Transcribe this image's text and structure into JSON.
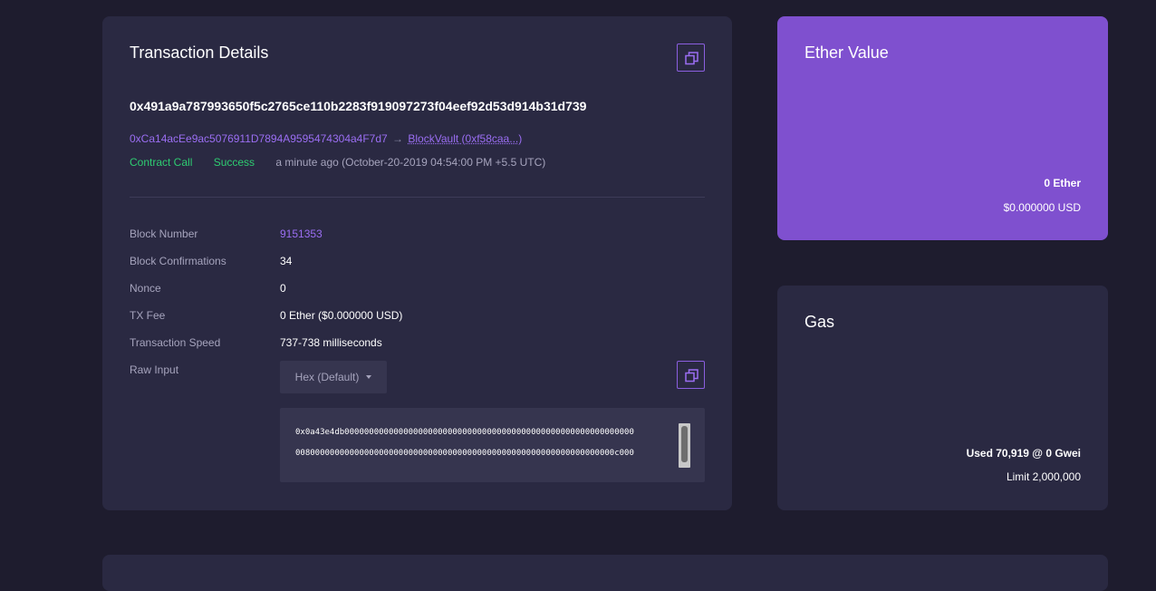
{
  "transaction": {
    "title": "Transaction Details",
    "hash": "0x491a9a787993650f5c2765ce110b2283f919097273f04eef92d53d914b31d739",
    "from": "0xCa14acEe9ac5076911D7894A9595474304a4F7d7",
    "arrow": "→",
    "to": "BlockVault (0xf58caa...)",
    "type": "Contract Call",
    "status": "Success",
    "time": "a minute ago (October-20-2019 04:54:00 PM +5.5 UTC)",
    "details": {
      "block_number_label": "Block Number",
      "block_number": "9151353",
      "confirmations_label": "Block Confirmations",
      "confirmations": "34",
      "nonce_label": "Nonce",
      "nonce": "0",
      "fee_label": "TX Fee",
      "fee": "0 Ether ($0.000000 USD)",
      "speed_label": "Transaction Speed",
      "speed": "737-738 milliseconds",
      "raw_input_label": "Raw Input",
      "raw_format": "Hex (Default)",
      "raw_line_1": "0x0a43e4db00000000000000000000000000000000000000000000000000000000000",
      "raw_line_2": "00800000000000000000000000000000000000000000000000000000000000000c000"
    }
  },
  "ether_value": {
    "title": "Ether Value",
    "ether": "0 Ether",
    "usd": "$0.000000 USD"
  },
  "gas": {
    "title": "Gas",
    "used": "Used 70,919 @ 0 Gwei",
    "limit": "Limit 2,000,000"
  },
  "colors": {
    "background": "#1e1c2e",
    "card": "#2a2942",
    "accent": "#7f50cf",
    "link": "#9b6ef3",
    "success": "#2ecc71"
  }
}
